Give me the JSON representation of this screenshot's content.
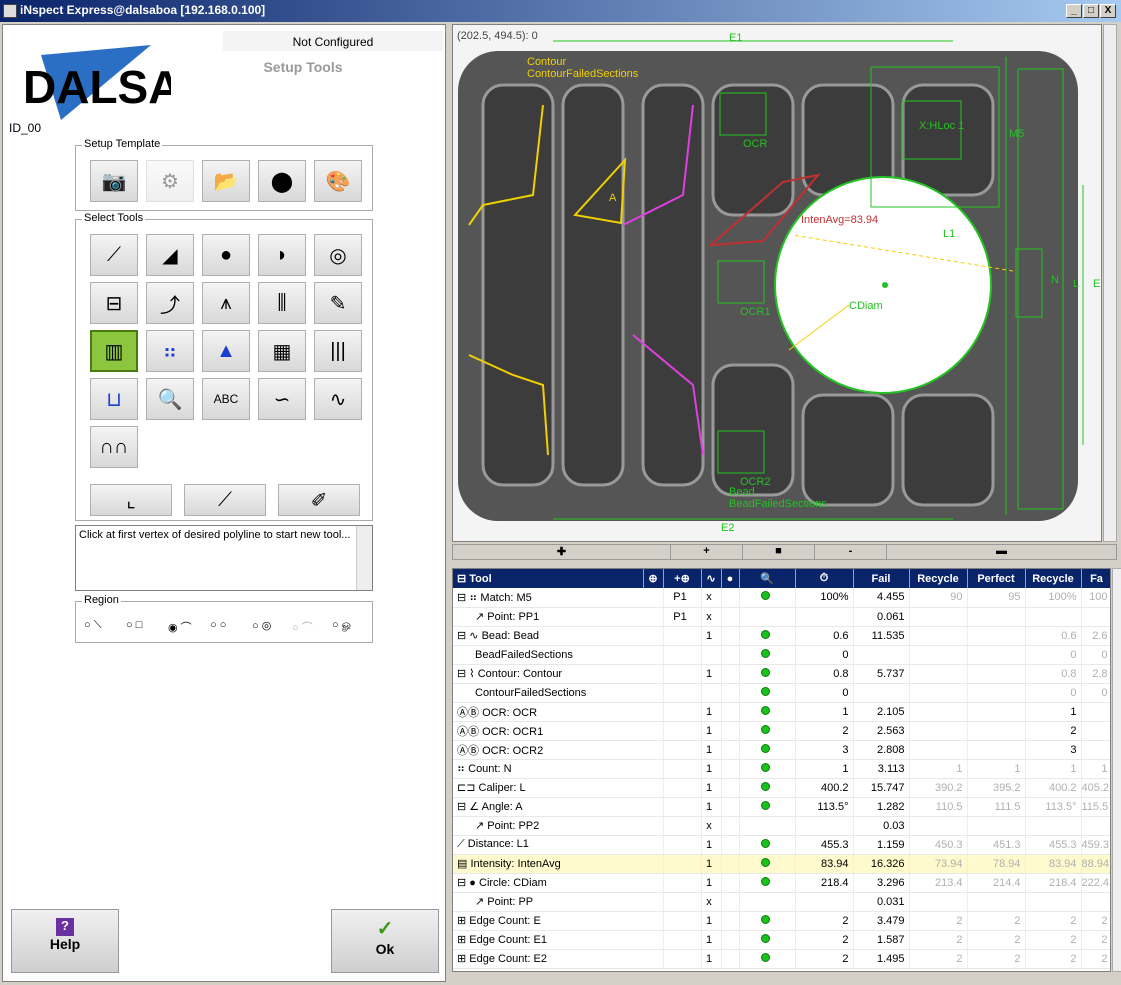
{
  "window": {
    "title": "iNspect Express@dalsaboa [192.168.0.100]",
    "min": "_",
    "max": "□",
    "close": "X"
  },
  "left": {
    "logo": "DALSA",
    "status": "Not Configured",
    "subtitle": "Setup Tools",
    "id": "ID_00",
    "setup_template_label": "Setup Template",
    "select_tools_label": "Select Tools",
    "hint": "Click at first vertex of desired polyline to start new tool...",
    "region_label": "Region",
    "help": "Help",
    "ok": "Ok",
    "help_icon": "?",
    "ok_icon": "✓"
  },
  "image": {
    "coords": "(202.5, 494.5): 0",
    "labels": {
      "e1": "E1",
      "e2": "E2",
      "contour": "Contour",
      "contour_failed": "ContourFailedSections",
      "ocr": "OCR",
      "ocr1": "OCR1",
      "ocr2": "OCR2",
      "bead": "Bead",
      "bead_failed": "BeadFailedSections",
      "inten": "IntenAvg=83.94",
      "l1": "L1",
      "cdiam": "CDiam",
      "m5": "M5",
      "a": "A",
      "xhl": "X:HLoc 1",
      "n": "N",
      "l": "L",
      "e": "E"
    }
  },
  "hbar": {
    "plus1": "✚",
    "plus2": "+",
    "stop": "■",
    "minus1": "-",
    "minus2": "▬"
  },
  "grid": {
    "columns": [
      "Tool",
      "",
      "",
      "",
      "",
      "",
      "Fail",
      "Recycle",
      "Perfect",
      "Recycle",
      "Fa"
    ],
    "icons": [
      "crosshair-icon",
      "add-crosshair-icon",
      "wave-icon",
      "traffic-light-icon",
      "magnifier-icon",
      "stopwatch-icon"
    ],
    "header_glyphs": [
      "⊕",
      "+⊕",
      "∿",
      "●",
      "🔍",
      "⏱"
    ],
    "rows": [
      {
        "exp": "⊟",
        "icon": "⠶",
        "name": "Match: M5",
        "ref": "P1",
        "x": "x",
        "val": "100%",
        "time": "4.455",
        "f": "90",
        "r": "95",
        "p": "100%",
        "r2": "100",
        "fa": "",
        "gray": true
      },
      {
        "exp": "",
        "icon": "↗",
        "name": "Point: PP1",
        "indent": true,
        "ref": "P1",
        "x": "x",
        "val": "",
        "time": "0.061",
        "f": "",
        "r": "",
        "p": "",
        "r2": "",
        "fa": "",
        "nodot": true
      },
      {
        "exp": "⊟",
        "icon": "∿",
        "name": "Bead: Bead",
        "ref": "",
        "x": "1",
        "val": "0.6",
        "time": "11.535",
        "f": "",
        "r": "",
        "p": "0.6",
        "r2": "2.6",
        "fa": "",
        "gray": true
      },
      {
        "exp": "",
        "icon": "",
        "name": "BeadFailedSections",
        "indent": true,
        "ref": "",
        "x": "",
        "val": "0",
        "time": "",
        "f": "",
        "r": "",
        "p": "0",
        "r2": "0",
        "fa": "",
        "gray": true
      },
      {
        "exp": "⊟",
        "icon": "⌇",
        "name": "Contour: Contour",
        "ref": "",
        "x": "1",
        "val": "0.8",
        "time": "5.737",
        "f": "",
        "r": "",
        "p": "0.8",
        "r2": "2.8",
        "fa": "",
        "gray": true
      },
      {
        "exp": "",
        "icon": "",
        "name": "ContourFailedSections",
        "indent": true,
        "ref": "",
        "x": "",
        "val": "0",
        "time": "",
        "f": "",
        "r": "",
        "p": "0",
        "r2": "0",
        "fa": "",
        "gray": true
      },
      {
        "exp": "",
        "icon": "ⒶⒷ",
        "name": "OCR: OCR",
        "ref": "",
        "x": "1",
        "val": "1",
        "time": "2.105",
        "f": "",
        "r": "",
        "p": "1",
        "r2": "",
        "fa": ""
      },
      {
        "exp": "",
        "icon": "ⒶⒷ",
        "name": "OCR: OCR1",
        "ref": "",
        "x": "1",
        "val": "2",
        "time": "2.563",
        "f": "",
        "r": "",
        "p": "2",
        "r2": "",
        "fa": ""
      },
      {
        "exp": "",
        "icon": "ⒶⒷ",
        "name": "OCR: OCR2",
        "ref": "",
        "x": "1",
        "val": "3",
        "time": "2.808",
        "f": "",
        "r": "",
        "p": "3",
        "r2": "",
        "fa": ""
      },
      {
        "exp": "",
        "icon": "⠶",
        "name": "Count: N",
        "ref": "",
        "x": "1",
        "val": "1",
        "time": "3.113",
        "f": "1",
        "r": "1",
        "p": "1",
        "r2": "1",
        "fa": "",
        "gray": true
      },
      {
        "exp": "",
        "icon": "⊏⊐",
        "name": "Caliper: L",
        "ref": "",
        "x": "1",
        "val": "400.2",
        "time": "15.747",
        "f": "390.2",
        "r": "395.2",
        "p": "400.2",
        "r2": "405.2",
        "fa": "4",
        "gray": true
      },
      {
        "exp": "⊟",
        "icon": "∠",
        "name": "Angle: A",
        "ref": "",
        "x": "1",
        "val": "113.5°",
        "time": "1.282",
        "f": "110.5",
        "r": "111.5",
        "p": "113.5°",
        "r2": "115.5",
        "fa": "1",
        "gray": true
      },
      {
        "exp": "",
        "icon": "↗",
        "name": "Point: PP2",
        "indent": true,
        "ref": "",
        "x": "x",
        "val": "",
        "time": "0.03",
        "f": "",
        "r": "",
        "p": "",
        "r2": "",
        "fa": "",
        "nodot": true
      },
      {
        "exp": "",
        "icon": "⟋",
        "name": "Distance: L1",
        "ref": "",
        "x": "1",
        "val": "455.3",
        "time": "1.159",
        "f": "450.3",
        "r": "451.3",
        "p": "455.3",
        "r2": "459.3",
        "fa": "4",
        "gray": true
      },
      {
        "exp": "",
        "icon": "▤",
        "name": "Intensity: IntenAvg",
        "ref": "",
        "x": "1",
        "val": "83.94",
        "time": "16.326",
        "f": "73.94",
        "r": "78.94",
        "p": "83.94",
        "r2": "88.94",
        "fa": "9",
        "gray": true,
        "hl": true
      },
      {
        "exp": "⊟",
        "icon": "●",
        "name": "Circle: CDiam",
        "ref": "",
        "x": "1",
        "val": "218.4",
        "time": "3.296",
        "f": "213.4",
        "r": "214.4",
        "p": "218.4",
        "r2": "222.4",
        "fa": "1",
        "gray": true
      },
      {
        "exp": "",
        "icon": "↗",
        "name": "Point: PP",
        "indent": true,
        "ref": "",
        "x": "x",
        "val": "",
        "time": "0.031",
        "f": "",
        "r": "",
        "p": "",
        "r2": "",
        "fa": "",
        "nodot": true
      },
      {
        "exp": "",
        "icon": "⊞",
        "name": "Edge Count: E",
        "ref": "",
        "x": "1",
        "val": "2",
        "time": "3.479",
        "f": "2",
        "r": "2",
        "p": "2",
        "r2": "2",
        "fa": "",
        "gray": true
      },
      {
        "exp": "",
        "icon": "⊞",
        "name": "Edge Count: E1",
        "ref": "",
        "x": "1",
        "val": "2",
        "time": "1.587",
        "f": "2",
        "r": "2",
        "p": "2",
        "r2": "2",
        "fa": "",
        "gray": true
      },
      {
        "exp": "",
        "icon": "⊞",
        "name": "Edge Count: E2",
        "ref": "",
        "x": "1",
        "val": "2",
        "time": "1.495",
        "f": "2",
        "r": "2",
        "p": "2",
        "r2": "2",
        "fa": "",
        "gray": true
      }
    ]
  }
}
